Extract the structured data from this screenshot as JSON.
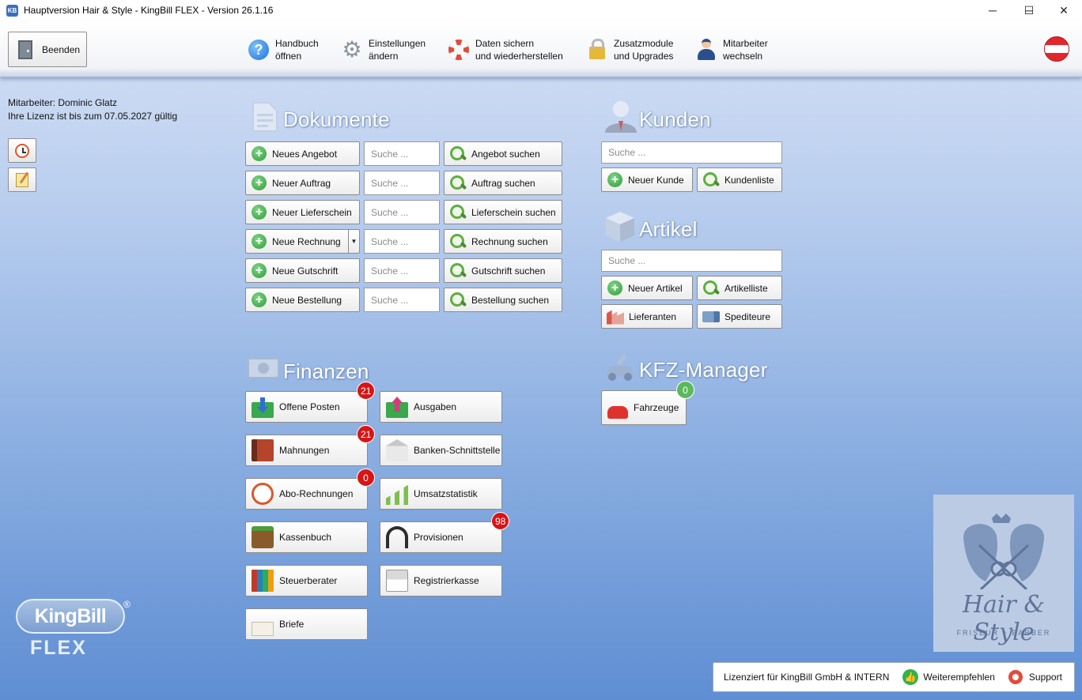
{
  "window": {
    "app_icon": "KB",
    "title": "Hauptversion Hair & Style - KingBill FLEX - Version 26.1.16",
    "controls": {
      "minimize": "─",
      "maximize": "☐",
      "close": "✕"
    }
  },
  "toolbar": {
    "exit_label": "Beenden",
    "items": [
      {
        "label": "Handbuch\nöffnen",
        "icon": "help-icon"
      },
      {
        "label": "Einstellungen\nändern",
        "icon": "gear-icon"
      },
      {
        "label": "Daten sichern\nund wiederherstellen",
        "icon": "lifebuoy-icon"
      },
      {
        "label": "Zusatzmodule\nund Upgrades",
        "icon": "lock-icon"
      },
      {
        "label": "Mitarbeiter\nwechseln",
        "icon": "user-icon"
      }
    ],
    "flag_icon": "austria-flag-icon"
  },
  "info": {
    "employee": "Mitarbeiter: Dominic Glatz",
    "license": "Ihre Lizenz ist bis zum 07.05.2027 gültig"
  },
  "dokumente": {
    "title": "Dokumente",
    "search_placeholder": "Suche ...",
    "rows": [
      {
        "new_label": "Neues Angebot",
        "find_label": "Angebot suchen"
      },
      {
        "new_label": "Neuer Auftrag",
        "find_label": "Auftrag suchen"
      },
      {
        "new_label": "Neuer Lieferschein",
        "find_label": "Lieferschein suchen"
      },
      {
        "new_label": "Neue Rechnung",
        "find_label": "Rechnung suchen",
        "has_dropdown": true
      },
      {
        "new_label": "Neue Gutschrift",
        "find_label": "Gutschrift suchen"
      },
      {
        "new_label": "Neue Bestellung",
        "find_label": "Bestellung suchen"
      }
    ]
  },
  "kunden": {
    "title": "Kunden",
    "search_placeholder": "Suche ...",
    "new_label": "Neuer Kunde",
    "list_label": "Kundenliste"
  },
  "artikel": {
    "title": "Artikel",
    "search_placeholder": "Suche ...",
    "new_label": "Neuer Artikel",
    "list_label": "Artikelliste",
    "suppliers_label": "Lieferanten",
    "carriers_label": "Spediteure"
  },
  "kfz": {
    "title": "KFZ-Manager",
    "vehicles_label": "Fahrzeuge",
    "vehicles_badge": "0"
  },
  "finanzen": {
    "title": "Finanzen",
    "buttons": [
      {
        "label": "Offene Posten",
        "badge": "21",
        "icon": "inbox-arrow-down-icon"
      },
      {
        "label": "Ausgaben",
        "badge": "",
        "icon": "inbox-arrow-up-icon"
      },
      {
        "label": "Mahnungen",
        "badge": "21",
        "icon": "book-icon"
      },
      {
        "label": "Banken-Schnittstelle",
        "badge": "",
        "icon": "bank-icon"
      },
      {
        "label": "Abo-Rechnungen",
        "badge": "0",
        "icon": "timer-icon"
      },
      {
        "label": "Umsatzstatistik",
        "badge": "",
        "icon": "chart-icon"
      },
      {
        "label": "Kassenbuch",
        "badge": "",
        "icon": "wallet-icon"
      },
      {
        "label": "Provisionen",
        "badge": "98",
        "icon": "headset-icon"
      },
      {
        "label": "Steuerberater",
        "badge": "",
        "icon": "binders-icon"
      },
      {
        "label": "Registrierkasse",
        "badge": "",
        "icon": "cash-register-icon"
      },
      {
        "label": "Briefe",
        "badge": "",
        "icon": "letter-icon"
      }
    ]
  },
  "logo": {
    "kingbill": "KingBill",
    "registered": "®",
    "flex": "FLEX"
  },
  "brand": {
    "name": "Hair & Style",
    "subtitle": "FRISEUR + BARBER"
  },
  "footer": {
    "licensed": "Lizenziert für KingBill GmbH & INTERN",
    "recommend_label": "Weiterempfehlen",
    "support_label": "Support"
  },
  "colors": {
    "badge_red": "#d81515",
    "badge_green": "#5cb85c",
    "plus_green": "#2d9b3a",
    "background_top": "#d6e2f6",
    "background_bottom": "#5f8ed3"
  }
}
